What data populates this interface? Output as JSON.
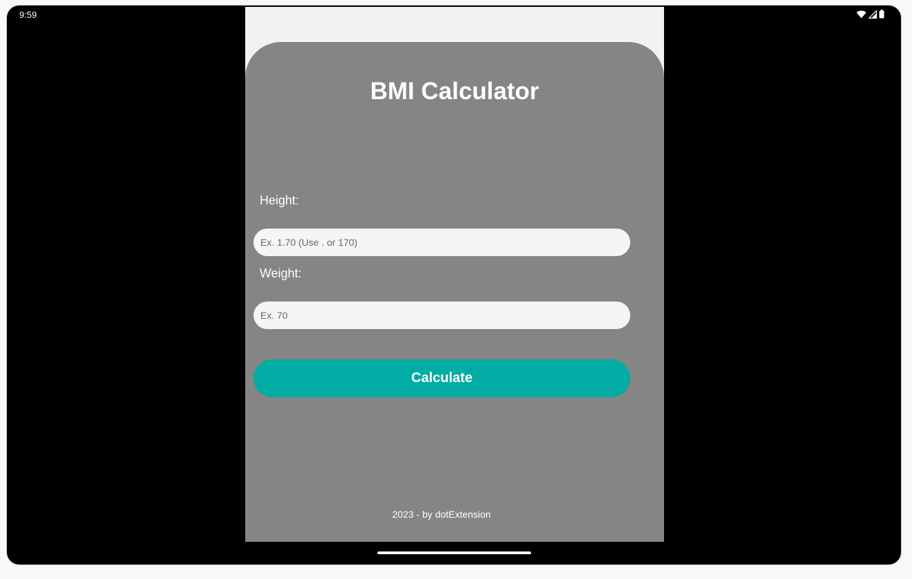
{
  "status_bar": {
    "time": "9:59",
    "icons": [
      "wifi-icon",
      "signal-icon",
      "battery-icon"
    ]
  },
  "app": {
    "title": "BMI Calculator",
    "height": {
      "label": "Height:",
      "placeholder": "Ex. 1.70 (Use . or 170)",
      "value": ""
    },
    "weight": {
      "label": "Weight:",
      "placeholder": "Ex. 70",
      "value": ""
    },
    "calculate_label": "Calculate",
    "footer": "2023 - by dotExtension"
  },
  "colors": {
    "card_background": "#858585",
    "accent": "#00aca3",
    "app_background": "#f2f2f2",
    "device_frame": "#000000"
  }
}
